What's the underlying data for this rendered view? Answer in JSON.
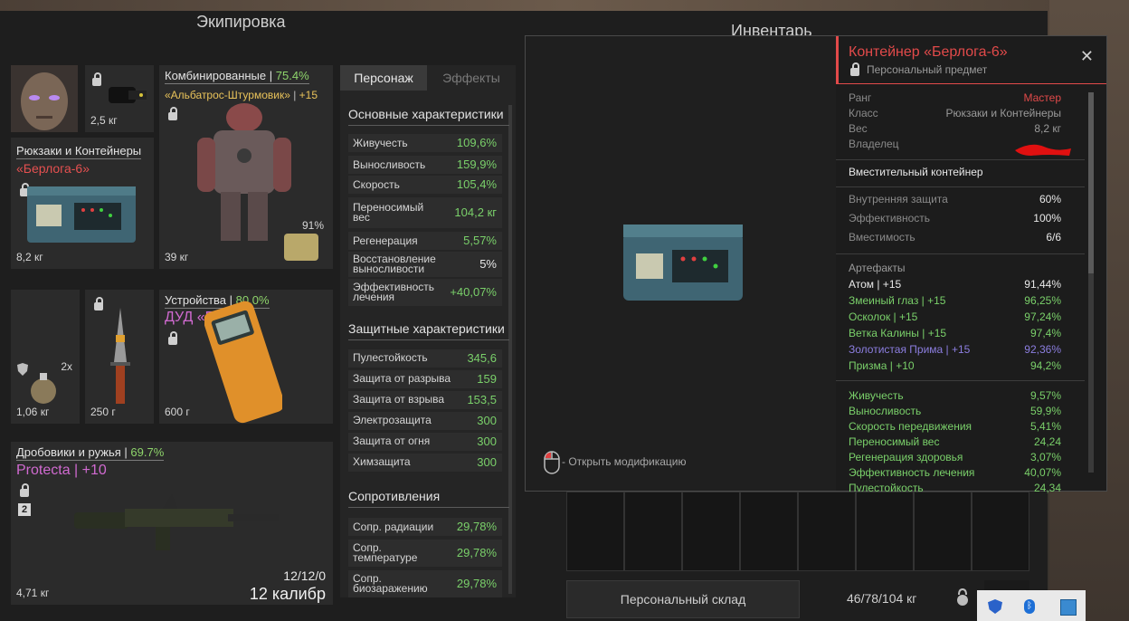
{
  "headers": {
    "equipment": "Экипировка",
    "inventory": "Инвентарь"
  },
  "slots": {
    "helmet": {
      "weight": "2,5 кг"
    },
    "backpack": {
      "category": "Рюкзаки и Контейнеры",
      "name": "«Берлога-6»",
      "weight": "8,2 кг"
    },
    "armor": {
      "category": "Комбинированные",
      "separator": "|",
      "percent": "75.4%",
      "name": "«Альбатрос-Штурмовик»",
      "upgrade": "+15",
      "durability": "91%",
      "weight": "39 кг"
    },
    "grenade": {
      "count": "2x",
      "weight": "1,06 кг"
    },
    "knife": {
      "weight": "250 г"
    },
    "device": {
      "category": "Устройства",
      "separator": "|",
      "percent": "80.0%",
      "name": "ДУД «Буря»",
      "weight": "600 г"
    },
    "weapon": {
      "category": "Дробовики и ружья",
      "separator": "|",
      "percent": "69.7%",
      "name": "Protecta",
      "upgrade": "| +10",
      "level": "2",
      "ammo_count": "12/12/0",
      "caliber": "12 калибр",
      "weight": "4,71 кг"
    }
  },
  "stats": {
    "tabs": [
      "Персонаж",
      "Эффекты"
    ],
    "basic_title": "Основные характеристики",
    "basic": [
      {
        "label": "Живучесть",
        "value": "109,6%",
        "color": "#7ad06a"
      },
      {
        "label": "Выносливость",
        "value": "159,9%",
        "color": "#7ad06a"
      },
      {
        "label": "Скорость",
        "value": "105,4%",
        "color": "#7ad06a"
      },
      {
        "label": "Переносимый\nвес",
        "value": "104,2 кг",
        "color": "#7ad06a"
      },
      {
        "label": "Регенерация",
        "value": "5,57%",
        "color": "#7ad06a"
      },
      {
        "label": "Восстановление\nвыносливости",
        "value": "5%",
        "color": "#e8e8e8"
      },
      {
        "label": "Эффективность\nлечения",
        "value": "+40,07%",
        "color": "#7ad06a"
      }
    ],
    "protect_title": "Защитные характеристики",
    "protect": [
      {
        "label": "Пулестойкость",
        "value": "345,6"
      },
      {
        "label": "Защита от разрыва",
        "value": "159"
      },
      {
        "label": "Защита от взрыва",
        "value": "153,5"
      },
      {
        "label": "Электрозащита",
        "value": "300"
      },
      {
        "label": "Защита от огня",
        "value": "300"
      },
      {
        "label": "Химзащита",
        "value": "300"
      }
    ],
    "resist_title": "Сопротивления",
    "resist": [
      {
        "label": "Сопр. радиации",
        "value": "29,78%"
      },
      {
        "label": "Сопр.\nтемпературе",
        "value": "29,78%"
      },
      {
        "label": "Сопр.\nбиозаражению",
        "value": "29,78%"
      }
    ]
  },
  "viewer": {
    "hint": "- Открыть модификацию"
  },
  "info": {
    "title": "Контейнер «Берлога-6»",
    "subtitle": "Персональный предмет",
    "props": [
      {
        "label": "Ранг",
        "value": "Мастер",
        "color": "#e24a4a"
      },
      {
        "label": "Класс",
        "value": "Рюкзаки и Контейнеры",
        "color": "#9a9a9a"
      },
      {
        "label": "Вес",
        "value": "8,2 кг",
        "color": "#9a9a9a"
      },
      {
        "label": "Владелец",
        "value": "",
        "color": "#9a9a9a"
      }
    ],
    "container_type": "Вместительный контейнер",
    "container": [
      {
        "label": "Внутренняя защита",
        "value": "60%"
      },
      {
        "label": "Эффективность",
        "value": "100%"
      },
      {
        "label": "Вместимость",
        "value": "6/6"
      }
    ],
    "artifacts_title": "Артефакты",
    "artifacts": [
      {
        "label": "Атом | +15",
        "value": "91,44%",
        "color": "#e8e8e8"
      },
      {
        "label": "Змеиный глаз | +15",
        "value": "96,25%",
        "color": "#7ad06a"
      },
      {
        "label": "Осколок | +15",
        "value": "97,24%",
        "color": "#7ad06a"
      },
      {
        "label": "Ветка Калины | +15",
        "value": "97,4%",
        "color": "#7ad06a"
      },
      {
        "label": "Золотистая Прима | +15",
        "value": "92,36%",
        "color": "#8c7ee0"
      },
      {
        "label": "Призма | +10",
        "value": "94,2%",
        "color": "#7ad06a"
      }
    ],
    "bonuses": [
      {
        "label": "Живучесть",
        "value": "9,57%"
      },
      {
        "label": "Выносливость",
        "value": "59,9%"
      },
      {
        "label": "Скорость передвижения",
        "value": "5,41%"
      },
      {
        "label": "Переносимый вес",
        "value": "24,24"
      },
      {
        "label": "Регенерация здоровья",
        "value": "3,07%"
      },
      {
        "label": "Эффективность лечения",
        "value": "40,07%"
      },
      {
        "label": "Пулестойкость",
        "value": "24,34"
      }
    ]
  },
  "storage": {
    "label": "Персональный склад",
    "weight": "46/78/104 кг"
  },
  "colors": {
    "accent_red": "#e24a4a",
    "green": "#7ad06a",
    "pink": "#d06ad0",
    "gold": "#e8c25a"
  }
}
